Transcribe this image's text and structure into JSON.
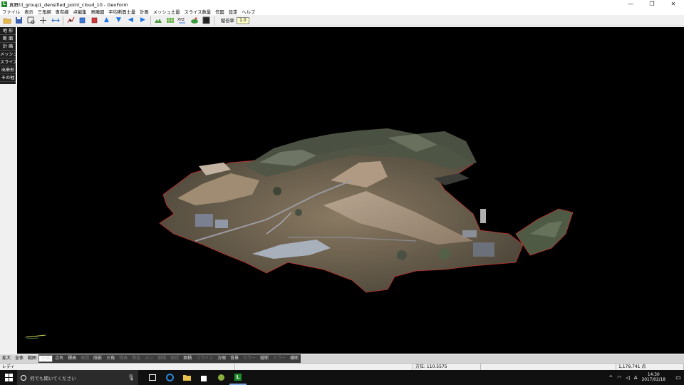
{
  "window": {
    "title": "真野川_group1_densified_point_cloud_10 - GeoForm",
    "app_icon_letter": "L",
    "controls": [
      "—",
      "❐",
      "✕"
    ]
  },
  "menu": [
    "ファイル",
    "表示",
    "三角網",
    "専有線",
    "点編集",
    "鳥瞰図",
    "平均断面土量",
    "計画",
    "メッシュ土量",
    "スライス数量",
    "作図",
    "設定",
    "ヘルプ"
  ],
  "toolbar": {
    "icons": [
      "open-folder-icon",
      "save-icon",
      "zoom-window-icon",
      "pan-icon",
      "fit-view-icon",
      "plot-icon",
      "cube-blue-icon",
      "cube-red-icon",
      "arrow-up-icon",
      "arrow-down-icon",
      "arrow-left-icon",
      "arrow-right-icon",
      "terrain-icon",
      "terrain-grid-icon",
      "xyz-icon",
      "hill-icon",
      "screen-icon"
    ],
    "vertical_ratio_label": "縦倍率",
    "vertical_ratio_value": "1.0"
  },
  "sidebar": {
    "items": [
      "地 形",
      "断 面",
      "計 画",
      "メッシュ",
      "スライス",
      "出来形",
      "その他"
    ]
  },
  "bottom_tools": {
    "left": [
      "拡大",
      "全体",
      "範囲"
    ],
    "selected": "座標",
    "group1": [
      "点名",
      "標高",
      "高程",
      "陰影",
      "三角"
    ],
    "group2": [
      "等高",
      "等色",
      "メシ",
      "面積",
      "面状",
      "面積"
    ],
    "group3": [
      "スライス",
      "方眼",
      "背景",
      "カラー",
      "縦断",
      "カラー",
      "横断"
    ]
  },
  "status": {
    "ready": "レディ",
    "bearing": "方位: 110.5575",
    "coordinate": "1,179,741 点"
  },
  "taskbar": {
    "search_placeholder": "何でも聞いてください",
    "ime_indicator": "A",
    "time": "14:30",
    "date": "2017/02/18"
  },
  "colors": {
    "viewport_bg": "#000000",
    "sidebar_bg": "#1e1e1e",
    "taskbar_bg": "#101010",
    "boundary": "#c0302a"
  }
}
